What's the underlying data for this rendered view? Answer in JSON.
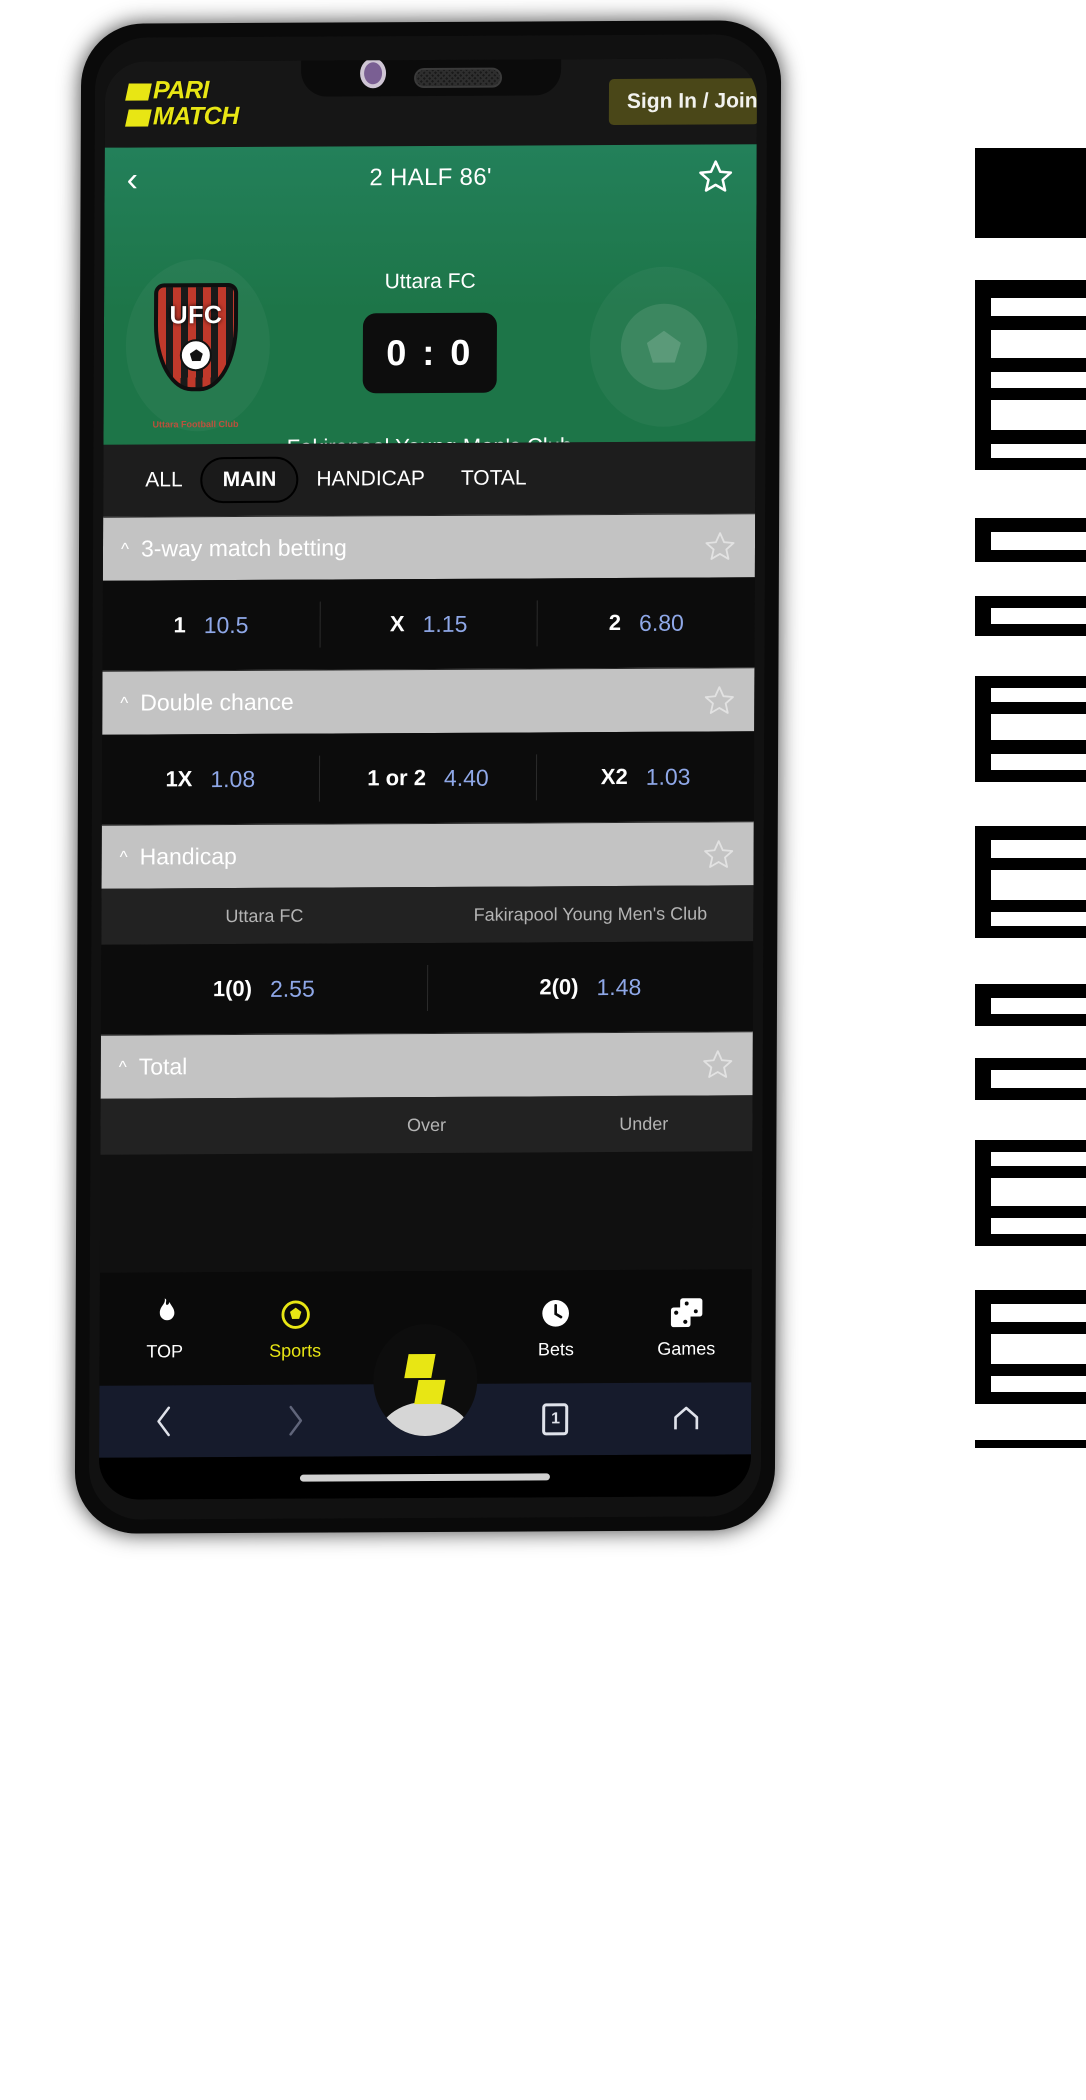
{
  "app": {
    "brand_line1": "PARI",
    "brand_line2": "MATCH",
    "signin_label": "Sign In / Join",
    "brand_color": "#e8e614"
  },
  "match": {
    "status": "2 HALF 86'",
    "back_icon": "chevron-left-icon",
    "favorite_icon": "star-outline-icon",
    "home_team": "Uttara FC",
    "away_team": "Fakirapool Young Men's Club",
    "score": "0 : 0",
    "home_crest_text": "UFC",
    "home_crest_caption": "Uttara Football Club",
    "banner_color": "#1d7548"
  },
  "tabs": [
    {
      "label": "ALL",
      "active": false
    },
    {
      "label": "MAIN",
      "active": true
    },
    {
      "label": "HANDICAP",
      "active": false
    },
    {
      "label": "TOTAL",
      "active": false
    }
  ],
  "sections": [
    {
      "title": "3-way match betting",
      "caret": "chevron-up-icon",
      "star": "star-outline-icon",
      "subheaders": [],
      "odds": [
        {
          "label": "1",
          "value": "10.5"
        },
        {
          "label": "X",
          "value": "1.15"
        },
        {
          "label": "2",
          "value": "6.80"
        }
      ]
    },
    {
      "title": "Double chance",
      "caret": "chevron-up-icon",
      "star": "star-outline-icon",
      "subheaders": [],
      "odds": [
        {
          "label": "1X",
          "value": "1.08"
        },
        {
          "label": "1 or 2",
          "value": "4.40"
        },
        {
          "label": "X2",
          "value": "1.03"
        }
      ]
    },
    {
      "title": "Handicap",
      "caret": "chevron-up-icon",
      "star": "star-outline-icon",
      "subheaders": [
        "Uttara FC",
        "Fakirapool Young Men's Club"
      ],
      "odds": [
        {
          "label": "1(0)",
          "value": "2.55"
        },
        {
          "label": "2(0)",
          "value": "1.48"
        }
      ]
    },
    {
      "title": "Total",
      "caret": "chevron-up-icon",
      "star": "star-outline-icon",
      "subheaders": [
        "Over",
        "Under"
      ],
      "odds": []
    }
  ],
  "bottom_nav": [
    {
      "label": "TOP",
      "icon": "flame-icon",
      "active": false
    },
    {
      "label": "Sports",
      "icon": "soccer-ball-icon",
      "active": true
    },
    {
      "label": "Bets",
      "icon": "clock-icon",
      "active": false
    },
    {
      "label": "Games",
      "icon": "dice-icon",
      "active": false
    }
  ],
  "center_button": {
    "icon": "parimatch-logo-icon"
  },
  "browser_nav": {
    "back": "chevron-left-icon",
    "forward": "chevron-right-icon",
    "menu": "hamburger-icon",
    "tab_count": "1",
    "home": "home-icon"
  }
}
